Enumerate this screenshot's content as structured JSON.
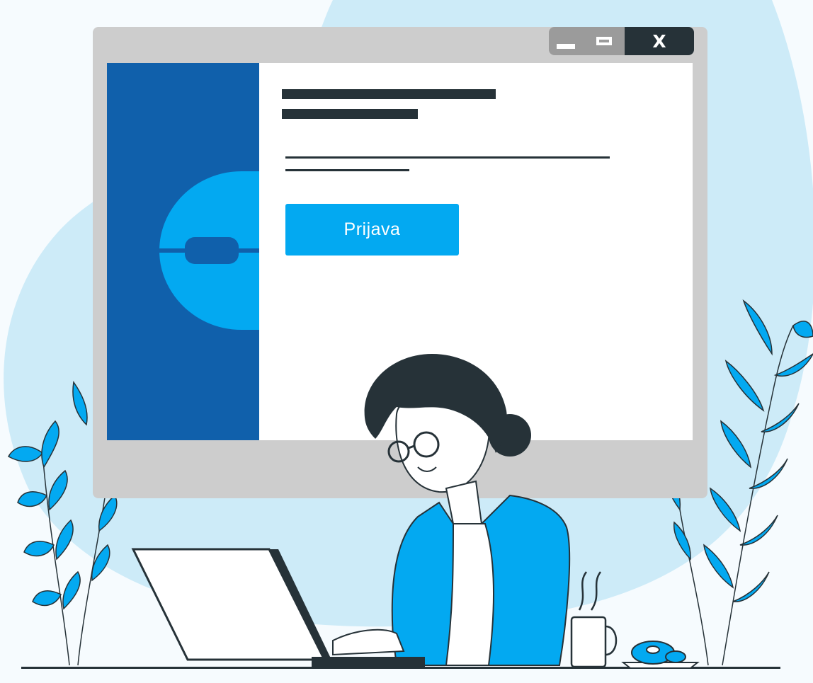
{
  "window": {
    "controls": {
      "minimize_icon": "minimize-icon",
      "maximize_icon": "maximize-icon",
      "close_label": "X"
    }
  },
  "login_form": {
    "submit_label": "Prijava"
  },
  "colors": {
    "sidebar": "#1060ab",
    "button": "#03a9f1",
    "dark": "#263238",
    "blob": "#cdebf8",
    "window_frame": "#cdcdcd",
    "plant": "#03a9f1"
  }
}
